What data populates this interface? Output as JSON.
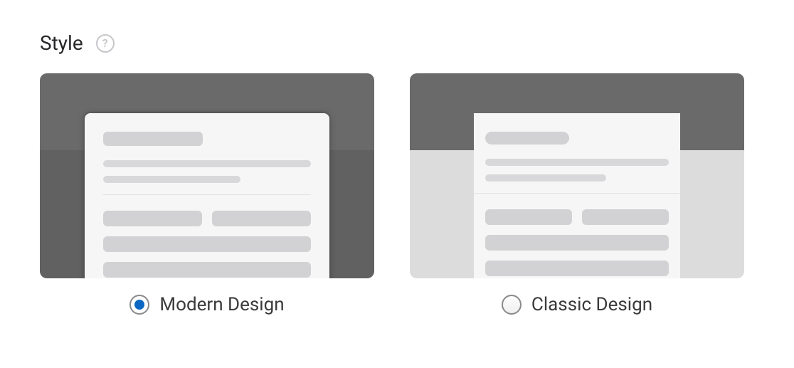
{
  "section": {
    "title": "Style"
  },
  "options": {
    "modern": {
      "label": "Modern Design",
      "selected": true
    },
    "classic": {
      "label": "Classic Design",
      "selected": false
    }
  }
}
